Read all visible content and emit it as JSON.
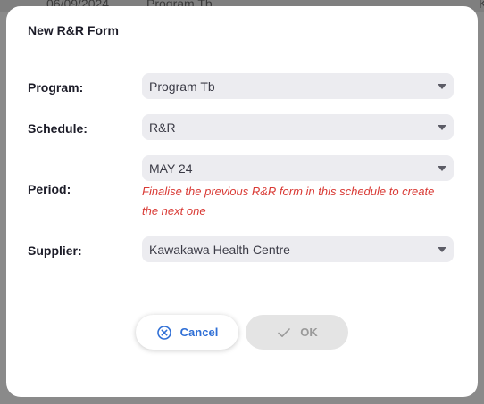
{
  "backdrop": {
    "date": "06/09/2024",
    "program": "Program Tb",
    "extra": "K"
  },
  "modal": {
    "title": "New R&R Form"
  },
  "form": {
    "program": {
      "label": "Program:",
      "value": "Program Tb"
    },
    "schedule": {
      "label": "Schedule:",
      "value": "R&R"
    },
    "period": {
      "label": "Period:",
      "value": "MAY 24",
      "error_line1": "Finalise the previous R&R form in this schedule to create",
      "error_line2": "the next one"
    },
    "supplier": {
      "label": "Supplier:",
      "value": "Kawakawa Health Centre"
    }
  },
  "buttons": {
    "cancel": {
      "label": "Cancel",
      "icon": "close-circle-icon",
      "color": "#2f6fd6"
    },
    "ok": {
      "label": "OK",
      "icon": "check-icon",
      "disabled": true
    }
  },
  "colors": {
    "error": "#d93a35",
    "field_bg": "#ececf0",
    "accent": "#2f6fd6"
  }
}
